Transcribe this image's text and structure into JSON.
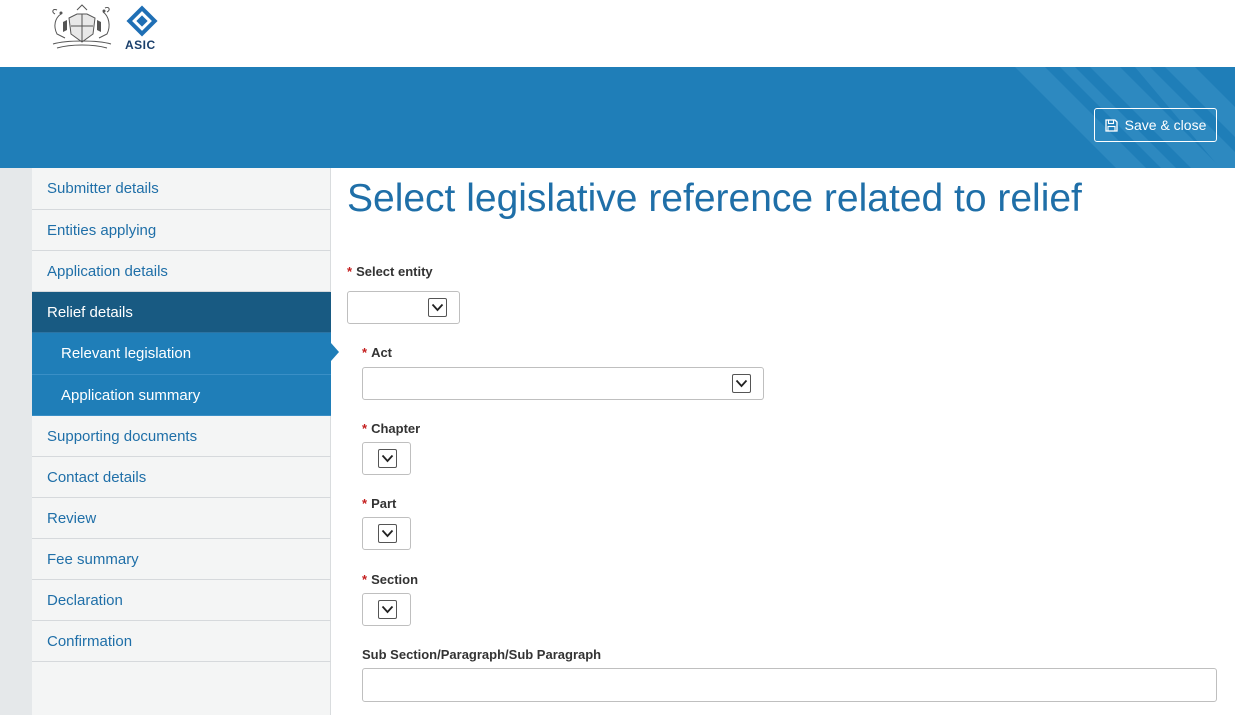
{
  "header": {
    "logo_text": "ASIC",
    "save_close_label": "Save & close"
  },
  "sidebar": {
    "items": [
      {
        "label": "Submitter details"
      },
      {
        "label": "Entities applying"
      },
      {
        "label": "Application details"
      },
      {
        "label": "Relief details"
      },
      {
        "label": "Relevant legislation"
      },
      {
        "label": "Application summary"
      },
      {
        "label": "Supporting documents"
      },
      {
        "label": "Contact details"
      },
      {
        "label": "Review"
      },
      {
        "label": "Fee summary"
      },
      {
        "label": "Declaration"
      },
      {
        "label": "Confirmation"
      }
    ],
    "active_item": "Relief details",
    "current_sub_item": "Relevant legislation"
  },
  "main": {
    "title": "Select legislative reference related to relief",
    "required_marker": "*",
    "fields": {
      "select_entity": {
        "label": "Select entity",
        "value": ""
      },
      "act": {
        "label": "Act",
        "value": ""
      },
      "chapter": {
        "label": "Chapter",
        "value": ""
      },
      "part": {
        "label": "Part",
        "value": ""
      },
      "section": {
        "label": "Section",
        "value": ""
      },
      "sub_section": {
        "label": "Sub Section/Paragraph/Sub Paragraph",
        "value": ""
      }
    }
  },
  "colors": {
    "brand_blue": "#1f7eb8",
    "active_nav": "#185a82",
    "link_blue": "#1f6fa8",
    "required_red": "#c41e1e"
  },
  "icons": [
    "coat-of-arms-icon",
    "asic-logo-icon",
    "save-disk-icon",
    "chevron-down-icon"
  ]
}
